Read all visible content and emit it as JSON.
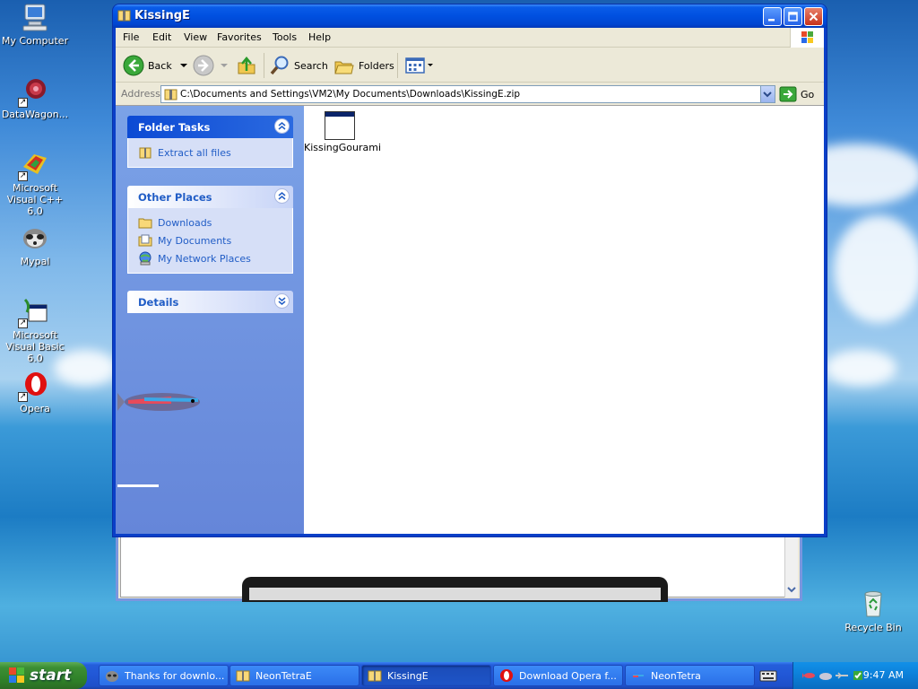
{
  "desktop": {
    "icons": [
      {
        "label": "My Computer",
        "icon": "my-computer-icon"
      },
      {
        "label": "DataWagon...",
        "icon": "datawagon-icon"
      },
      {
        "label": "Microsoft Visual C++ 6.0",
        "icon": "visual-cpp-icon"
      },
      {
        "label": "Mypal",
        "icon": "mypal-icon"
      },
      {
        "label": "Microsoft Visual Basic 6.0",
        "icon": "visual-basic-icon"
      },
      {
        "label": "Opera",
        "icon": "opera-icon"
      },
      {
        "label": "Recycle Bin",
        "icon": "recycle-bin-icon"
      }
    ]
  },
  "window": {
    "title": "KissingE",
    "menu": [
      "File",
      "Edit",
      "View",
      "Favorites",
      "Tools",
      "Help"
    ],
    "toolbar": {
      "back": "Back",
      "search": "Search",
      "folders": "Folders"
    },
    "address": {
      "label": "Address",
      "path": "C:\\Documents and Settings\\VM2\\My Documents\\Downloads\\KissingE.zip",
      "go": "Go"
    },
    "panels": {
      "folder_tasks": {
        "title": "Folder Tasks",
        "items": [
          "Extract all files"
        ]
      },
      "other_places": {
        "title": "Other Places",
        "items": [
          "Downloads",
          "My Documents",
          "My Network Places"
        ]
      },
      "details": {
        "title": "Details"
      }
    },
    "files": [
      {
        "name": "KissingGourami"
      }
    ]
  },
  "taskbar": {
    "start": "start",
    "tasks": [
      {
        "label": "Thanks for downlo...",
        "active": false
      },
      {
        "label": "NeonTetraE",
        "active": false
      },
      {
        "label": "KissingE",
        "active": true
      },
      {
        "label": "Download Opera f...",
        "active": false
      },
      {
        "label": "NeonTetra",
        "active": false
      }
    ],
    "clock": "9:47 AM"
  },
  "colors": {
    "xp_blue": "#0050e0",
    "task_pane_link": "#215dc6",
    "start_green": "#3c8f34"
  }
}
